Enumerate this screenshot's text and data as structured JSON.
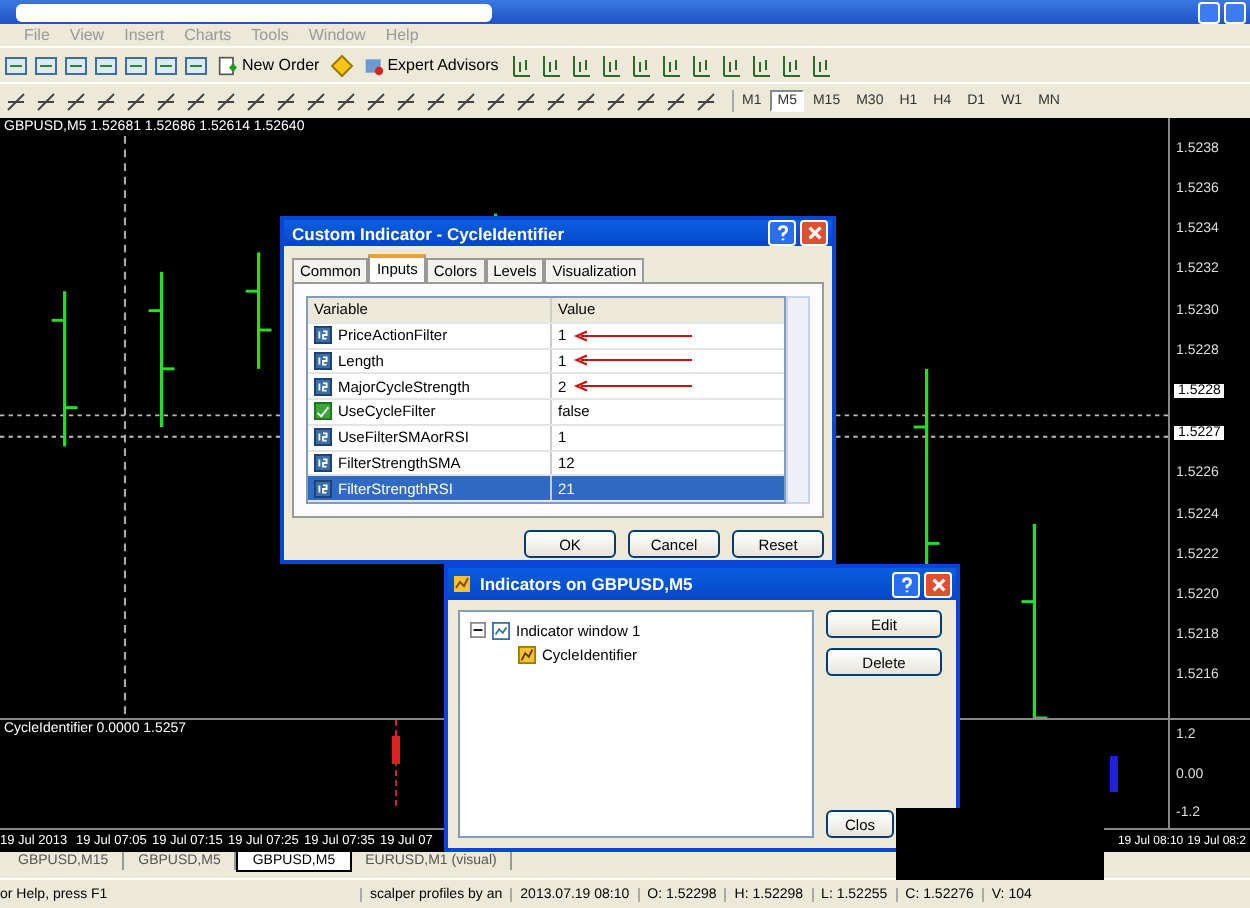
{
  "menu": [
    "File",
    "View",
    "Insert",
    "Charts",
    "Tools",
    "Window",
    "Help"
  ],
  "toolbar": {
    "buttons": [
      "New Order",
      "Expert Advisors"
    ]
  },
  "timeframes": [
    {
      "label": "M1",
      "selected": false
    },
    {
      "label": "M5",
      "selected": true
    },
    {
      "label": "M15",
      "selected": false
    },
    {
      "label": "M30",
      "selected": false
    },
    {
      "label": "H1",
      "selected": false
    },
    {
      "label": "H4",
      "selected": false
    },
    {
      "label": "D1",
      "selected": false
    },
    {
      "label": "W1",
      "selected": false
    },
    {
      "label": "MN",
      "selected": false
    }
  ],
  "chart": {
    "header": "GBPUSD,M5 1.52681 1.52686 1.52614 1.52640",
    "price_labels": [
      "1.5238",
      "1.5236",
      "1.5234",
      "1.5232",
      "1.5230",
      "1.5228",
      "1.5226",
      "1.5224",
      "1.5222",
      "1.5220",
      "1.5218",
      "1.5216"
    ],
    "price_markers": [
      "1.5228",
      "1.5227"
    ],
    "sub_header": "CycleIdentifier 0.0000 1.5257",
    "sub_labels": [
      "1.2",
      "0.00",
      "-1.2"
    ],
    "time_labels": [
      "19 Jul 2013",
      "19 Jul 07:05",
      "19 Jul 07:15",
      "19 Jul 07:25",
      "19 Jul 07:35",
      "19 Jul 07"
    ],
    "time_labels_right": [
      "19 Jul 08:10",
      "19 Jul 08:2"
    ]
  },
  "chart_tabs": [
    {
      "label": "GBPUSD,M15",
      "selected": false
    },
    {
      "label": "GBPUSD,M5",
      "selected": false
    },
    {
      "label": "GBPUSD,M5",
      "selected": true
    },
    {
      "label": "EURUSD,M1 (visual)",
      "selected": false
    }
  ],
  "status_bar": [
    "or Help, press F1",
    "scalper profiles by an",
    "2013.07.19 08:10",
    "O: 1.52298",
    "H: 1.52298",
    "L: 1.52255",
    "C: 1.52276",
    "V: 104"
  ],
  "indicator_dialog": {
    "title": "Custom Indicator - CycleIdentifier",
    "tabs": [
      {
        "label": "Common",
        "selected": false
      },
      {
        "label": "Inputs",
        "selected": true
      },
      {
        "label": "Colors",
        "selected": false
      },
      {
        "label": "Levels",
        "selected": false
      },
      {
        "label": "Visualization",
        "selected": false
      }
    ],
    "columns": [
      "Variable",
      "Value"
    ],
    "rows": [
      {
        "kind": "int",
        "variable": "PriceActionFilter",
        "value": "1",
        "arrow": true,
        "selected": false
      },
      {
        "kind": "int",
        "variable": "Length",
        "value": "1",
        "arrow": true,
        "selected": false
      },
      {
        "kind": "int",
        "variable": "MajorCycleStrength",
        "value": "2",
        "arrow": true,
        "selected": false
      },
      {
        "kind": "bool",
        "variable": "UseCycleFilter",
        "value": "false",
        "arrow": false,
        "selected": false
      },
      {
        "kind": "int",
        "variable": "UseFilterSMAorRSI",
        "value": "1",
        "arrow": false,
        "selected": false
      },
      {
        "kind": "int",
        "variable": "FilterStrengthSMA",
        "value": "12",
        "arrow": false,
        "selected": false
      },
      {
        "kind": "int",
        "variable": "FilterStrengthRSI",
        "value": "21",
        "arrow": false,
        "selected": true
      }
    ],
    "buttons": [
      "OK",
      "Cancel",
      "Reset"
    ]
  },
  "indicators_window": {
    "title": "Indicators on GBPUSD,M5",
    "tree": [
      {
        "label": "Indicator window 1",
        "expanded": true,
        "children": [
          {
            "label": "CycleIdentifier"
          }
        ]
      }
    ],
    "buttons": [
      "Edit",
      "Delete",
      "Clos"
    ]
  }
}
